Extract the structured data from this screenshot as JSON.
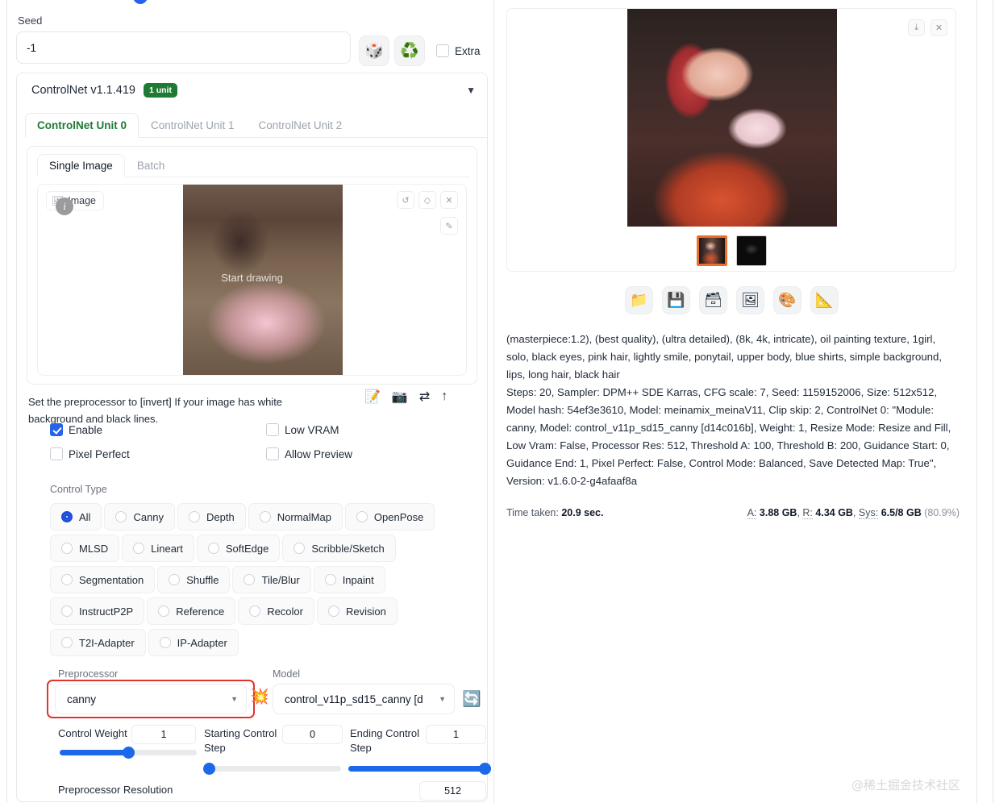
{
  "seed": {
    "label": "Seed",
    "value": "-1",
    "dice_icon": "dice-icon",
    "recycle_icon": "recycle-icon",
    "extra_label": "Extra",
    "extra_checked": false
  },
  "controlnet": {
    "title": "ControlNet v1.1.419",
    "badge": "1 unit",
    "caret": "▼",
    "unit_tabs": [
      {
        "label": "ControlNet Unit 0",
        "active": true
      },
      {
        "label": "ControlNet Unit 1",
        "active": false
      },
      {
        "label": "ControlNet Unit 2",
        "active": false
      }
    ],
    "sub_tabs": [
      {
        "label": "Single Image",
        "active": true
      },
      {
        "label": "Batch",
        "active": false
      }
    ],
    "image_chip": "Image",
    "info_badge": "i",
    "canvas_overlay": "Start drawing",
    "image_tools": [
      {
        "name": "undo-icon",
        "glyph": "↺"
      },
      {
        "name": "eraser-icon",
        "glyph": "◇"
      },
      {
        "name": "close-icon",
        "glyph": "✕"
      },
      {
        "name": "brush-icon",
        "glyph": "✎"
      }
    ],
    "hint": "Set the preprocessor to [invert] If your image has white background and black lines.",
    "hint_icons": [
      {
        "name": "edit-note-icon",
        "glyph": "📝"
      },
      {
        "name": "camera-icon",
        "glyph": "📷"
      },
      {
        "name": "swap-icon",
        "glyph": "⇄"
      },
      {
        "name": "upload-arrow-icon",
        "glyph": "↑"
      }
    ],
    "checkboxes": [
      {
        "label": "Enable",
        "checked": true
      },
      {
        "label": "Low VRAM",
        "checked": false
      },
      {
        "label": "Pixel Perfect",
        "checked": false
      },
      {
        "label": "Allow Preview",
        "checked": false
      }
    ],
    "control_type_label": "Control Type",
    "control_types": [
      {
        "label": "All",
        "selected": true
      },
      {
        "label": "Canny",
        "selected": false
      },
      {
        "label": "Depth",
        "selected": false
      },
      {
        "label": "NormalMap",
        "selected": false
      },
      {
        "label": "OpenPose",
        "selected": false
      },
      {
        "label": "MLSD",
        "selected": false
      },
      {
        "label": "Lineart",
        "selected": false
      },
      {
        "label": "SoftEdge",
        "selected": false
      },
      {
        "label": "Scribble/Sketch",
        "selected": false
      },
      {
        "label": "Segmentation",
        "selected": false
      },
      {
        "label": "Shuffle",
        "selected": false
      },
      {
        "label": "Tile/Blur",
        "selected": false
      },
      {
        "label": "Inpaint",
        "selected": false
      },
      {
        "label": "InstructP2P",
        "selected": false
      },
      {
        "label": "Reference",
        "selected": false
      },
      {
        "label": "Recolor",
        "selected": false
      },
      {
        "label": "Revision",
        "selected": false
      },
      {
        "label": "T2I-Adapter",
        "selected": false
      },
      {
        "label": "IP-Adapter",
        "selected": false
      }
    ],
    "preprocessor": {
      "label": "Preprocessor",
      "value": "canny",
      "highlight_color": "#e0352b",
      "marker_icon": "burst-icon"
    },
    "model": {
      "label": "Model",
      "value": "control_v11p_sd15_canny [d",
      "refresh_icon": "refresh-icon"
    },
    "sliders": [
      {
        "name": "control-weight",
        "label": "Control Weight",
        "value": "1",
        "pct": 50
      },
      {
        "name": "starting-control-step",
        "label": "Starting Control Step",
        "value": "0",
        "pct": 0
      },
      {
        "name": "ending-control-step",
        "label": "Ending Control Step",
        "value": "1",
        "pct": 100
      }
    ],
    "preprocessor_resolution": {
      "label": "Preprocessor Resolution",
      "value": "512"
    }
  },
  "result": {
    "tools": [
      {
        "name": "download-icon",
        "glyph": "⤓"
      },
      {
        "name": "close-icon",
        "glyph": "✕"
      }
    ],
    "thumbnails": [
      {
        "name": "result-thumb-generated",
        "selected": true
      },
      {
        "name": "result-thumb-canny-map",
        "selected": false
      }
    ],
    "actions": [
      {
        "name": "open-folder-icon",
        "glyph": "📁"
      },
      {
        "name": "save-icon",
        "glyph": "💾"
      },
      {
        "name": "zip-icon",
        "glyph": "🗃"
      },
      {
        "name": "send-to-img2img-icon",
        "glyph": "🖼"
      },
      {
        "name": "send-to-inpaint-icon",
        "glyph": "🎨"
      },
      {
        "name": "send-to-extras-icon",
        "glyph": "📐"
      }
    ],
    "prompt": "(masterpiece:1.2), (best quality), (ultra detailed), (8k, 4k, intricate), oil painting texture, 1girl, solo, black eyes, pink hair, lightly smile, ponytail, upper body, blue shirts, simple background, lips, long hair, black hair",
    "params": "Steps: 20, Sampler: DPM++ SDE Karras, CFG scale: 7, Seed: 1159152006, Size: 512x512, Model hash: 54ef3e3610, Model: meinamix_meinaV11, Clip skip: 2, ControlNet 0: \"Module: canny, Model: control_v11p_sd15_canny [d14c016b], Weight: 1, Resize Mode: Resize and Fill, Low Vram: False, Processor Res: 512, Threshold A: 100, Threshold B: 200, Guidance Start: 0, Guidance End: 1, Pixel Perfect: False, Control Mode: Balanced, Save Detected Map: True\", Version: v1.6.0-2-g4afaaf8a",
    "time_label": "Time taken:",
    "time_value": "20.9 sec.",
    "mem_a_label": "A:",
    "mem_a_value": "3.88 GB",
    "mem_r_label": "R:",
    "mem_r_value": "4.34 GB",
    "mem_sys_label": "Sys:",
    "mem_sys_value": "6.5/8 GB",
    "mem_sys_pct": "(80.9%)"
  },
  "watermark": "@稀土掘金技术社区"
}
